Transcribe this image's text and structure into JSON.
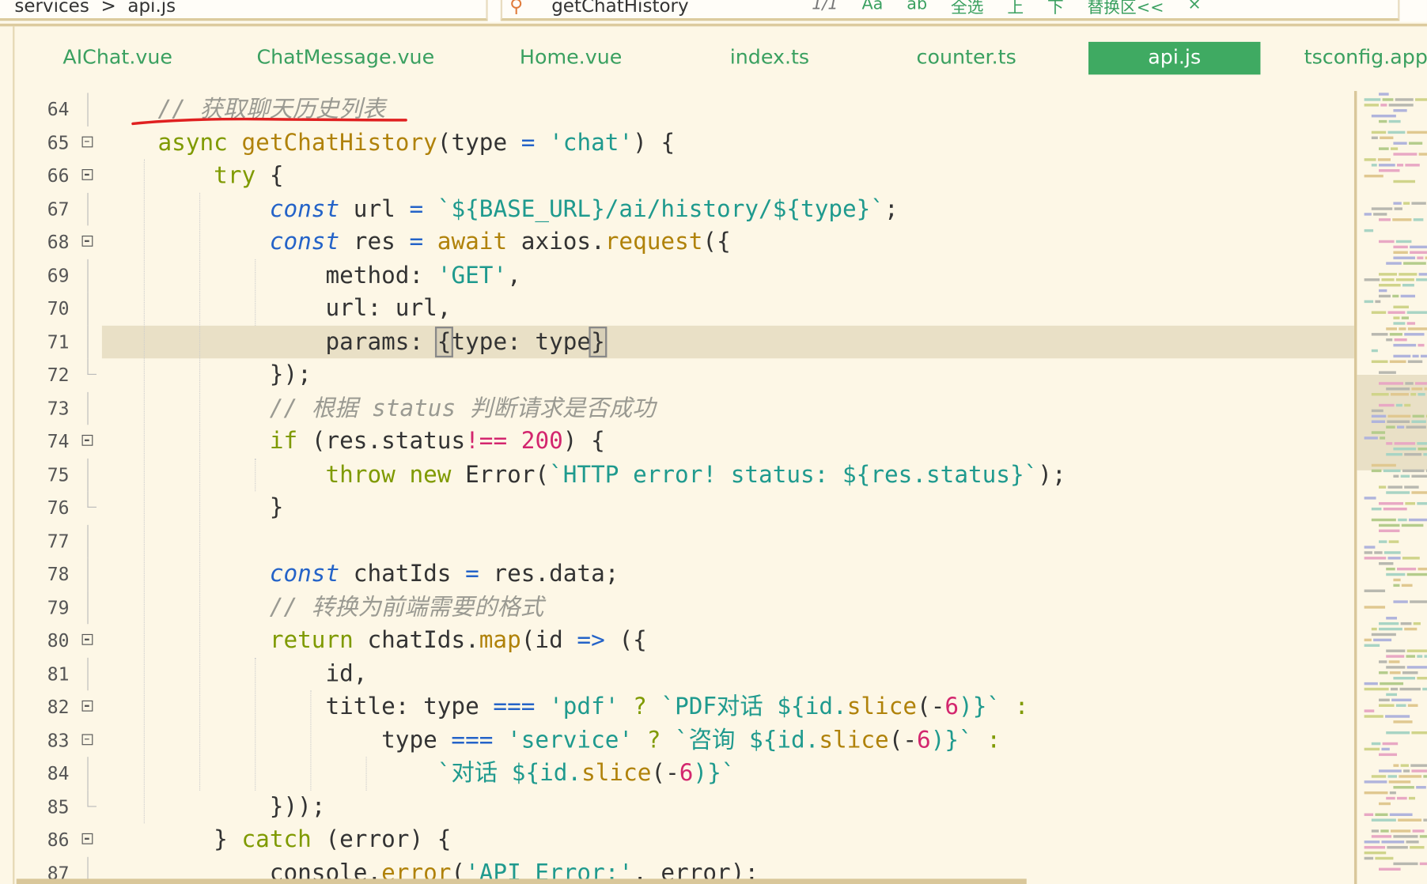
{
  "breadcrumb": {
    "text": "services  >  api.js"
  },
  "search": {
    "term": "getChatHistory",
    "count": "1/1",
    "tools": [
      "Aa",
      "ab",
      "全选",
      "上",
      "下",
      "替换区<<",
      "×"
    ]
  },
  "tabs": [
    {
      "label": "AIChat.vue",
      "active": false
    },
    {
      "label": "ChatMessage.vue",
      "active": false
    },
    {
      "label": "Home.vue",
      "active": false
    },
    {
      "label": "index.ts",
      "active": false
    },
    {
      "label": "counter.ts",
      "active": false
    },
    {
      "label": "api.js",
      "active": true
    },
    {
      "label": "tsconfig.app",
      "active": false
    }
  ],
  "colors": {
    "accent": "#3faa62",
    "background": "#fdf7e6",
    "highlight_line": "#e9e0c6",
    "annotation": "#e02020"
  },
  "highlighted_line": 71,
  "lines": [
    {
      "n": "64",
      "fold": "bar",
      "t": [
        [
          "cm",
          "    // 获取聊天历史列表"
        ]
      ]
    },
    {
      "n": "65",
      "fold": "box",
      "t": [
        [
          "p",
          "    "
        ],
        [
          "kw",
          "async"
        ],
        [
          "p",
          " "
        ],
        [
          "fn",
          "getChatHistory"
        ],
        [
          "p",
          "(type "
        ],
        [
          "op",
          "="
        ],
        [
          "p",
          " "
        ],
        [
          "str",
          "'chat'"
        ],
        [
          "p",
          ") {"
        ]
      ]
    },
    {
      "n": "66",
      "fold": "box",
      "t": [
        [
          "p",
          "        "
        ],
        [
          "kw",
          "try"
        ],
        [
          "p",
          " {"
        ]
      ]
    },
    {
      "n": "67",
      "fold": "bar",
      "t": [
        [
          "p",
          "            "
        ],
        [
          "decl",
          "const"
        ],
        [
          "p",
          " url "
        ],
        [
          "op",
          "="
        ],
        [
          "p",
          " "
        ],
        [
          "str",
          "`${BASE_URL}/ai/history/${type}`"
        ],
        [
          "p",
          ";"
        ]
      ]
    },
    {
      "n": "68",
      "fold": "box",
      "t": [
        [
          "p",
          "            "
        ],
        [
          "decl",
          "const"
        ],
        [
          "p",
          " res "
        ],
        [
          "op",
          "="
        ],
        [
          "p",
          " "
        ],
        [
          "fn",
          "await"
        ],
        [
          "p",
          " axios."
        ],
        [
          "fn",
          "request"
        ],
        [
          "p",
          "({"
        ]
      ]
    },
    {
      "n": "69",
      "fold": "bar",
      "t": [
        [
          "p",
          "                method: "
        ],
        [
          "str",
          "'GET'"
        ],
        [
          "p",
          ","
        ]
      ]
    },
    {
      "n": "70",
      "fold": "bar",
      "t": [
        [
          "p",
          "                url: url,"
        ]
      ]
    },
    {
      "n": "71",
      "fold": "bar",
      "t": [
        [
          "p",
          "                params: "
        ],
        [
          "br",
          "{"
        ],
        [
          "p",
          "type: type"
        ],
        [
          "br",
          "}"
        ]
      ]
    },
    {
      "n": "72",
      "fold": "end",
      "t": [
        [
          "p",
          "            });"
        ]
      ]
    },
    {
      "n": "73",
      "fold": "bar",
      "t": [
        [
          "cm",
          "            // 根据 status 判断请求是否成功"
        ]
      ]
    },
    {
      "n": "74",
      "fold": "box",
      "t": [
        [
          "p",
          "            "
        ],
        [
          "kw",
          "if"
        ],
        [
          "p",
          " (res.status"
        ],
        [
          "num",
          "!=="
        ],
        [
          "p",
          " "
        ],
        [
          "num",
          "200"
        ],
        [
          "p",
          ") {"
        ]
      ]
    },
    {
      "n": "75",
      "fold": "bar",
      "t": [
        [
          "p",
          "                "
        ],
        [
          "kw",
          "throw"
        ],
        [
          "p",
          " "
        ],
        [
          "kw",
          "new"
        ],
        [
          "p",
          " Error("
        ],
        [
          "str",
          "`HTTP error! status: ${res.status}`"
        ],
        [
          "p",
          ");"
        ]
      ]
    },
    {
      "n": "76",
      "fold": "end",
      "t": [
        [
          "p",
          "            }"
        ]
      ]
    },
    {
      "n": "77",
      "fold": "bar",
      "t": [
        [
          "p",
          ""
        ]
      ]
    },
    {
      "n": "78",
      "fold": "bar",
      "t": [
        [
          "p",
          "            "
        ],
        [
          "decl",
          "const"
        ],
        [
          "p",
          " chatIds "
        ],
        [
          "op",
          "="
        ],
        [
          "p",
          " res.data;"
        ]
      ]
    },
    {
      "n": "79",
      "fold": "bar",
      "t": [
        [
          "cm",
          "            // 转换为前端需要的格式"
        ]
      ]
    },
    {
      "n": "80",
      "fold": "box",
      "t": [
        [
          "p",
          "            "
        ],
        [
          "kw",
          "return"
        ],
        [
          "p",
          " chatIds."
        ],
        [
          "fn",
          "map"
        ],
        [
          "p",
          "(id "
        ],
        [
          "op",
          "=>"
        ],
        [
          "p",
          " ({"
        ]
      ]
    },
    {
      "n": "81",
      "fold": "bar",
      "t": [
        [
          "p",
          "                id,"
        ]
      ]
    },
    {
      "n": "82",
      "fold": "box",
      "t": [
        [
          "p",
          "                title: type "
        ],
        [
          "op",
          "==="
        ],
        [
          "p",
          " "
        ],
        [
          "str",
          "'pdf'"
        ],
        [
          "kw",
          " ? "
        ],
        [
          "str",
          "`PDF对话 ${id."
        ],
        [
          "fn",
          "slice"
        ],
        [
          "p",
          "(-"
        ],
        [
          "num",
          "6"
        ],
        [
          "str",
          ")}`"
        ],
        [
          "kw",
          " :"
        ]
      ]
    },
    {
      "n": "83",
      "fold": "box",
      "t": [
        [
          "p",
          "                    type "
        ],
        [
          "op",
          "==="
        ],
        [
          "p",
          " "
        ],
        [
          "str",
          "'service'"
        ],
        [
          "kw",
          " ? "
        ],
        [
          "str",
          "`咨询 ${id."
        ],
        [
          "fn",
          "slice"
        ],
        [
          "p",
          "(-"
        ],
        [
          "num",
          "6"
        ],
        [
          "str",
          ")}`"
        ],
        [
          "kw",
          " :"
        ]
      ]
    },
    {
      "n": "84",
      "fold": "bar",
      "t": [
        [
          "p",
          "                        "
        ],
        [
          "str",
          "`对话 ${id."
        ],
        [
          "fn",
          "slice"
        ],
        [
          "p",
          "(-"
        ],
        [
          "num",
          "6"
        ],
        [
          "str",
          ")}`"
        ]
      ]
    },
    {
      "n": "85",
      "fold": "end",
      "t": [
        [
          "p",
          "            }));"
        ]
      ]
    },
    {
      "n": "86",
      "fold": "box",
      "t": [
        [
          "p",
          "        } "
        ],
        [
          "kw",
          "catch"
        ],
        [
          "p",
          " (error) {"
        ]
      ]
    },
    {
      "n": "87",
      "fold": "bar",
      "t": [
        [
          "p",
          "            console."
        ],
        [
          "fn",
          "error"
        ],
        [
          "p",
          "("
        ],
        [
          "str",
          "'API Error:'"
        ],
        [
          "p",
          ", error);"
        ]
      ]
    }
  ]
}
